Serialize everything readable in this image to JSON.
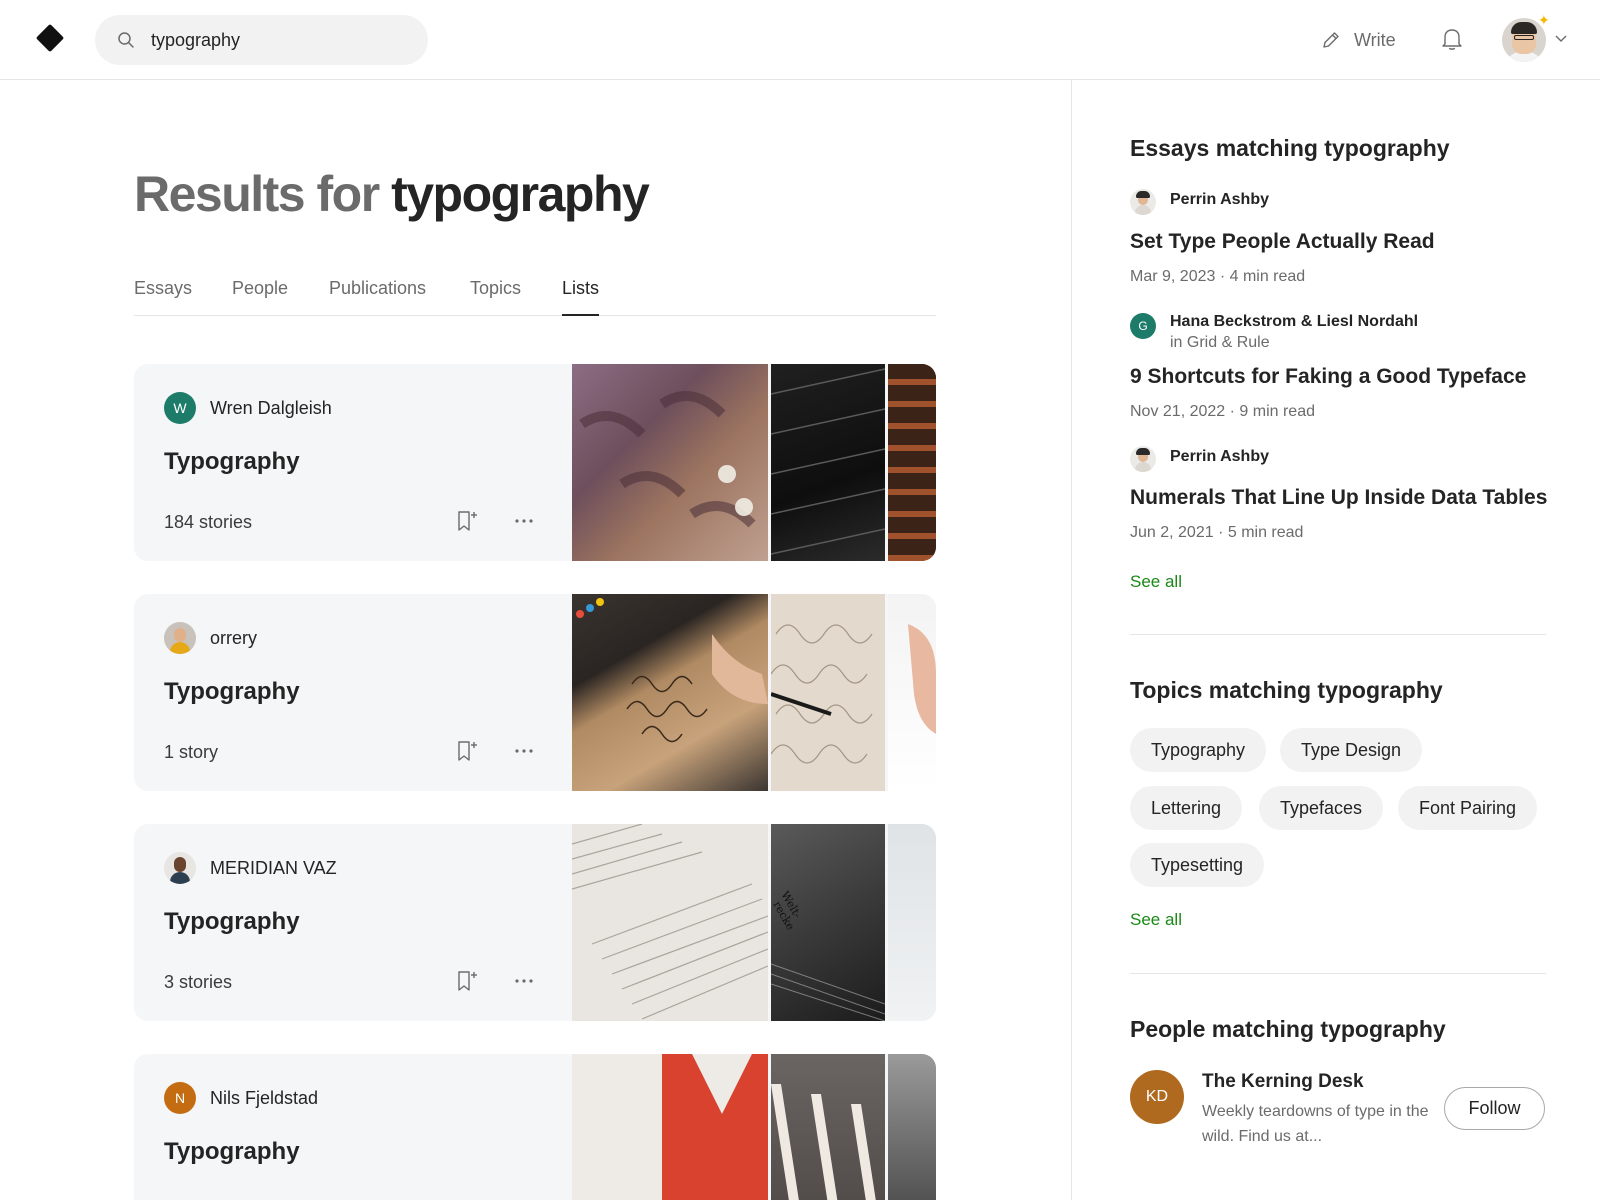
{
  "header": {
    "search_value": "typography",
    "write_label": "Write"
  },
  "main": {
    "title_prefix": "Results for",
    "title_query": "typography",
    "tabs": [
      {
        "label": "Essays",
        "active": false
      },
      {
        "label": "People",
        "active": false
      },
      {
        "label": "Publications",
        "active": false
      },
      {
        "label": "Topics",
        "active": false
      },
      {
        "label": "Lists",
        "active": true
      }
    ],
    "lists": [
      {
        "owner": "Wren Dalgleish",
        "owner_initial": "W",
        "owner_color": "#1d7b6a",
        "title": "Typography",
        "count": "184 stories"
      },
      {
        "owner": "orrery",
        "owner_initial": "",
        "owner_color": "#c9c2bb",
        "title": "Typography",
        "count": "1 story"
      },
      {
        "owner": "MERIDIAN VAZ",
        "owner_initial": "",
        "owner_color": "#e8e6e3",
        "title": "Typography",
        "count": "3 stories"
      },
      {
        "owner": "Nils Fjeldstad",
        "owner_initial": "N",
        "owner_color": "#c46c12",
        "title": "Typography",
        "count": ""
      }
    ]
  },
  "sidebar": {
    "essays_heading": "Essays matching typography",
    "essays": [
      {
        "author": "Perrin Ashby",
        "publication": "",
        "title": "Set Type People Actually Read",
        "meta": "Mar 9, 2023 · 4 min read"
      },
      {
        "author": "Hana Beckstrom & Liesl Nordahl",
        "author_initial": "G",
        "publication": "in Grid & Rule",
        "title": "9 Shortcuts for Faking a Good Typeface",
        "meta": "Nov 21, 2022 · 9 min read"
      },
      {
        "author": "Perrin Ashby",
        "publication": "",
        "title": "Numerals That Line Up Inside Data Tables",
        "meta": "Jun 2, 2021 · 5 min read"
      }
    ],
    "essays_see_all": "See all",
    "topics_heading": "Topics matching typography",
    "topics": [
      "Typography",
      "Type Design",
      "Lettering",
      "Typefaces",
      "Font Pairing",
      "Typesetting"
    ],
    "topics_see_all": "See all",
    "people_heading": "People matching typography",
    "person": {
      "initials": "KD",
      "name": "The Kerning Desk",
      "description": "Weekly teardowns of type in the wild. Find us at...",
      "follow_label": "Follow"
    }
  },
  "colors": {
    "accent_green": "#1a8917",
    "card_bg": "#f4f6f7",
    "topic_bg": "#f2f2f2"
  }
}
